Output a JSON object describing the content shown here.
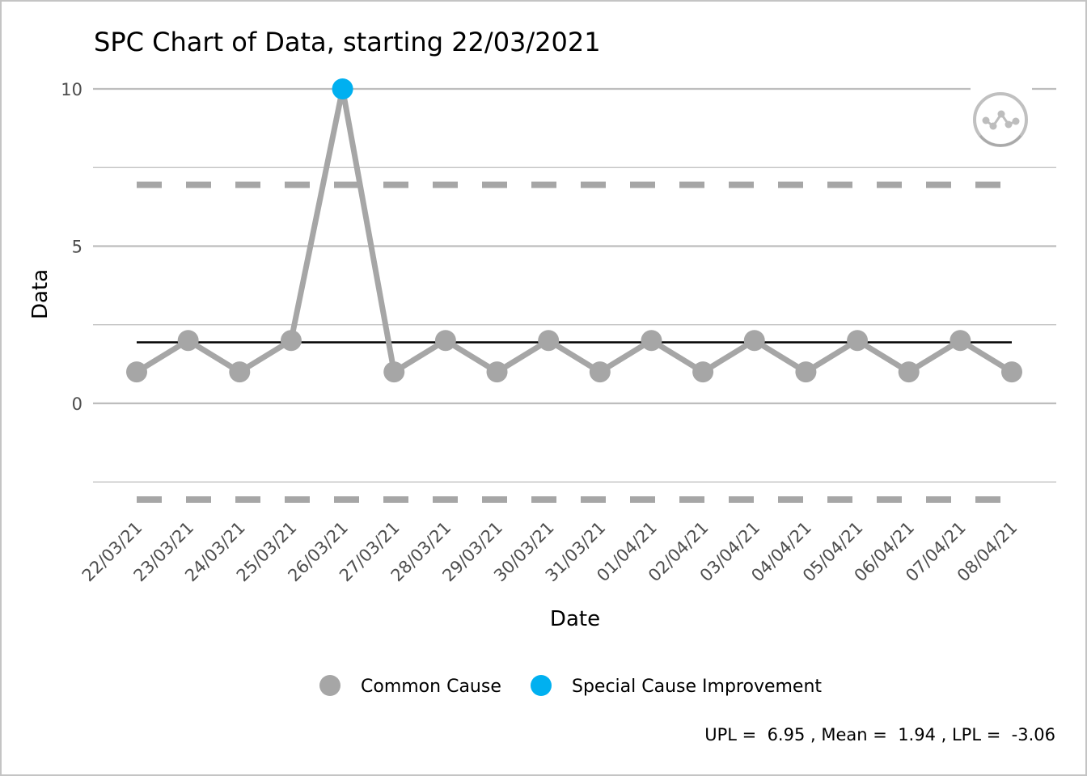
{
  "chart_data": {
    "type": "line",
    "title": "SPC Chart of Data, starting 22/03/2021",
    "xlabel": "Date",
    "ylabel": "Data",
    "ylim": [
      -2.5,
      10
    ],
    "y_ticks": [
      0,
      5,
      10
    ],
    "y_tick_labels": [
      "0",
      "5",
      "10"
    ],
    "grid": true,
    "categories": [
      "22/03/21",
      "23/03/21",
      "24/03/21",
      "25/03/21",
      "26/03/21",
      "27/03/21",
      "28/03/21",
      "29/03/21",
      "30/03/21",
      "31/03/21",
      "01/04/21",
      "02/04/21",
      "03/04/21",
      "04/04/21",
      "05/04/21",
      "06/04/21",
      "07/04/21",
      "08/04/21"
    ],
    "series": [
      {
        "name": "Data",
        "values": [
          1,
          2,
          1,
          2,
          10,
          1,
          2,
          1,
          2,
          1,
          2,
          1,
          2,
          1,
          2,
          1,
          2,
          1
        ],
        "point_types": [
          "Common Cause",
          "Common Cause",
          "Common Cause",
          "Common Cause",
          "Special Cause Improvement",
          "Common Cause",
          "Common Cause",
          "Common Cause",
          "Common Cause",
          "Common Cause",
          "Common Cause",
          "Common Cause",
          "Common Cause",
          "Common Cause",
          "Common Cause",
          "Common Cause",
          "Common Cause",
          "Common Cause"
        ]
      }
    ],
    "control_limits": {
      "upl": 6.95,
      "mean": 1.94,
      "lpl": -3.06
    },
    "legend": {
      "position": "bottom",
      "entries": [
        {
          "label": "Common Cause",
          "color": "#a6a6a6"
        },
        {
          "label": "Special Cause Improvement",
          "color": "#00b0f0"
        }
      ]
    },
    "caption": "UPL =  6.95 , Mean =  1.94 , LPL =  -3.06",
    "icon": "common-cause-variation-icon"
  },
  "colors": {
    "line": "#a6a6a6",
    "common_cause": "#a6a6a6",
    "special_improvement": "#00b0f0",
    "mean_line": "#000000",
    "limit_line": "#a6a6a6",
    "grid": "#bdbdbd"
  }
}
